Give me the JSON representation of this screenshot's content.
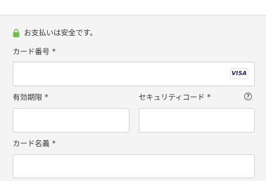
{
  "secure_notice": {
    "icon": "lock-icon",
    "icon_color": "#6cc04a",
    "text": "お支払いは安全です。"
  },
  "card_number": {
    "label": "カード番号 *",
    "value": "",
    "placeholder": "",
    "brand_badge": "VISA",
    "brand_color": "#1a1f71"
  },
  "expiry": {
    "label": "有効期限 *",
    "value": "",
    "placeholder": ""
  },
  "security_code": {
    "label": "セキュリティコード *",
    "value": "",
    "placeholder": "",
    "help_icon": "question-circle-icon",
    "help_glyph": "?"
  },
  "cardholder_name": {
    "label": "カード名義 *",
    "value": "",
    "placeholder": ""
  }
}
